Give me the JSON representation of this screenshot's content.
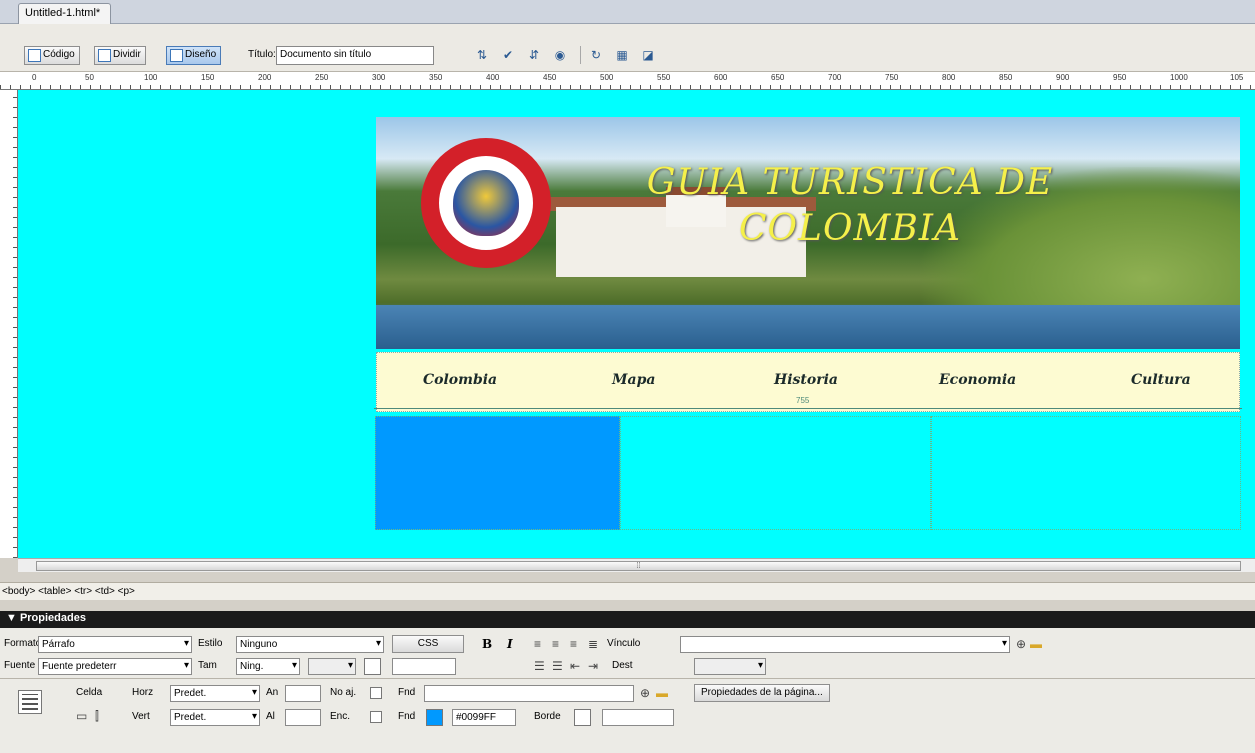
{
  "document": {
    "tab_label": "Untitled-1.html*"
  },
  "toolbar": {
    "code_label": "Código",
    "split_label": "Dividir",
    "design_label": "Diseño",
    "title_label": "Título:",
    "title_value": "Documento sin título",
    "icons": [
      "file-management-icon",
      "preview-icon",
      "debug-icon",
      "visual-aids-icon",
      "refresh-icon",
      "view-options-icon",
      "visual-aids-2-icon"
    ]
  },
  "ruler": {
    "marks": [
      "0",
      "50",
      "100",
      "150",
      "200",
      "250",
      "300",
      "350",
      "400",
      "450",
      "500",
      "550",
      "600",
      "650",
      "700",
      "750",
      "800",
      "850",
      "900",
      "950",
      "1000",
      "105"
    ]
  },
  "page": {
    "background": "#00ffff",
    "banner_title_line1": "GUIA TURISTICA DE",
    "banner_title_line2": "COLOMBIA",
    "seal_colors": {
      "ring": "#d32029",
      "title_color": "#f5f04a"
    },
    "nav": [
      "Colombia",
      "Mapa",
      "Historia",
      "Economia",
      "Cultura"
    ],
    "table_width_label": "755",
    "cell_color": "#0099ff"
  },
  "tag_selector": "<body> <table> <tr> <td> <p>",
  "properties": {
    "header": "▼ Propiedades",
    "format_label": "Formato",
    "format_value": "Párrafo",
    "style_label": "Estilo",
    "style_value": "Ninguno",
    "css_button": "CSS",
    "bold": "B",
    "italic": "I",
    "link_label": "Vínculo",
    "font_label": "Fuente",
    "font_value": "Fuente predeterr",
    "size_label": "Tam",
    "size_value": "Ning.",
    "target_label": "Dest",
    "cell_label": "Celda",
    "horz_label": "Horz",
    "horz_value": "Predet.",
    "width_label": "An",
    "nowrap_label": "No aj.",
    "bg_label": "Fnd",
    "page_props_button": "Propiedades de la página...",
    "vert_label": "Vert",
    "vert_value": "Predet.",
    "height_label": "Al",
    "header_label": "Enc.",
    "bgcolor_label": "Fnd",
    "bgcolor_value": "#0099FF",
    "border_label": "Borde"
  }
}
